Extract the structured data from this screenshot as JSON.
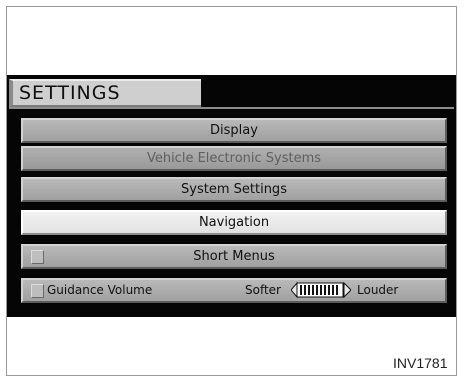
{
  "header": {
    "title": "SETTINGS"
  },
  "menu": {
    "display": "Display",
    "vehicle_electronic_systems": "Vehicle Electronic Systems",
    "system_settings": "System Settings",
    "navigation": "Navigation",
    "short_menus": "Short Menus",
    "guidance_volume": {
      "label": "Guidance Volume",
      "softer": "Softer",
      "louder": "Louder"
    }
  },
  "states": {
    "vehicle_electronic_systems_enabled": false,
    "navigation_selected": true,
    "short_menus_checked": false,
    "guidance_volume_checked": false
  },
  "caption": "INV1781"
}
